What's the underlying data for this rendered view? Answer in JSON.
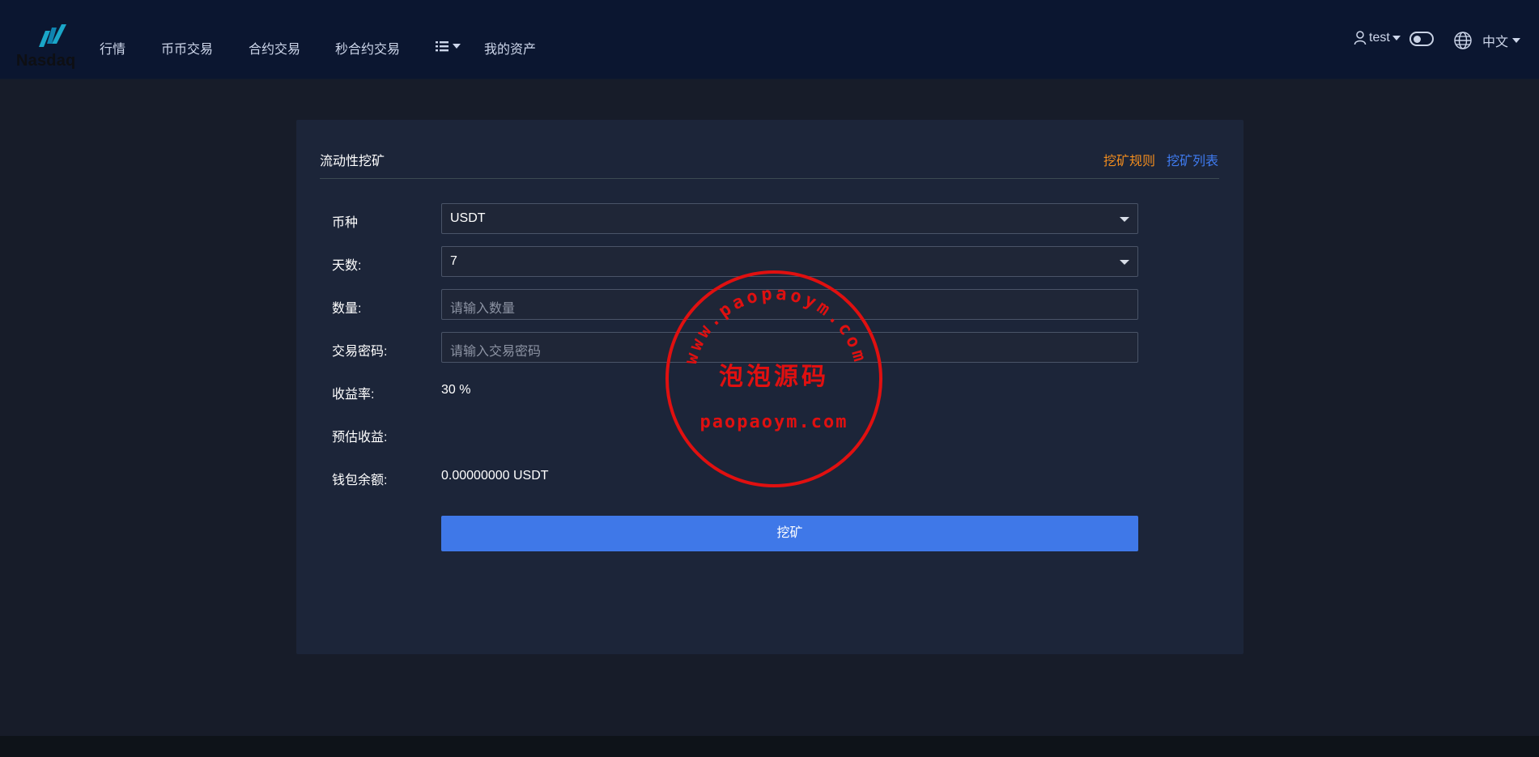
{
  "header": {
    "logo_text": "Nasdaq",
    "nav": [
      "行情",
      "币币交易",
      "合约交易",
      "秒合约交易"
    ],
    "assets_label": "我的资产",
    "user_name": "test",
    "language": "中文",
    "icons": [
      "nasdaq-logo",
      "list-menu-icon",
      "user-icon",
      "theme-toggle",
      "globe-icon"
    ]
  },
  "panel": {
    "title": "流动性挖矿",
    "rules_link": "挖矿规则",
    "list_link": "挖矿列表",
    "form": {
      "currency_label": "币种",
      "currency_value": "USDT",
      "days_label": "天数:",
      "days_value": "7",
      "amount_label": "数量:",
      "amount_placeholder": "请输入数量",
      "password_label": "交易密码:",
      "password_placeholder": "请输入交易密码",
      "yield_label": "收益率:",
      "yield_value": "30 %",
      "estimated_label": "预估收益:",
      "estimated_value": "",
      "balance_label": "钱包余额:",
      "balance_value": "0.00000000 USDT",
      "submit_label": "挖矿"
    }
  },
  "watermark": {
    "arc_text": "www.paopaoym.com",
    "center_text": "泡泡源码",
    "bottom_text": "paopaoym.com",
    "color": "#e01010"
  },
  "colors": {
    "accent_blue": "#3f78e8",
    "accent_orange": "#f08c1e",
    "nav_bg": "#0b1630",
    "panel_bg": "#1c2539"
  }
}
